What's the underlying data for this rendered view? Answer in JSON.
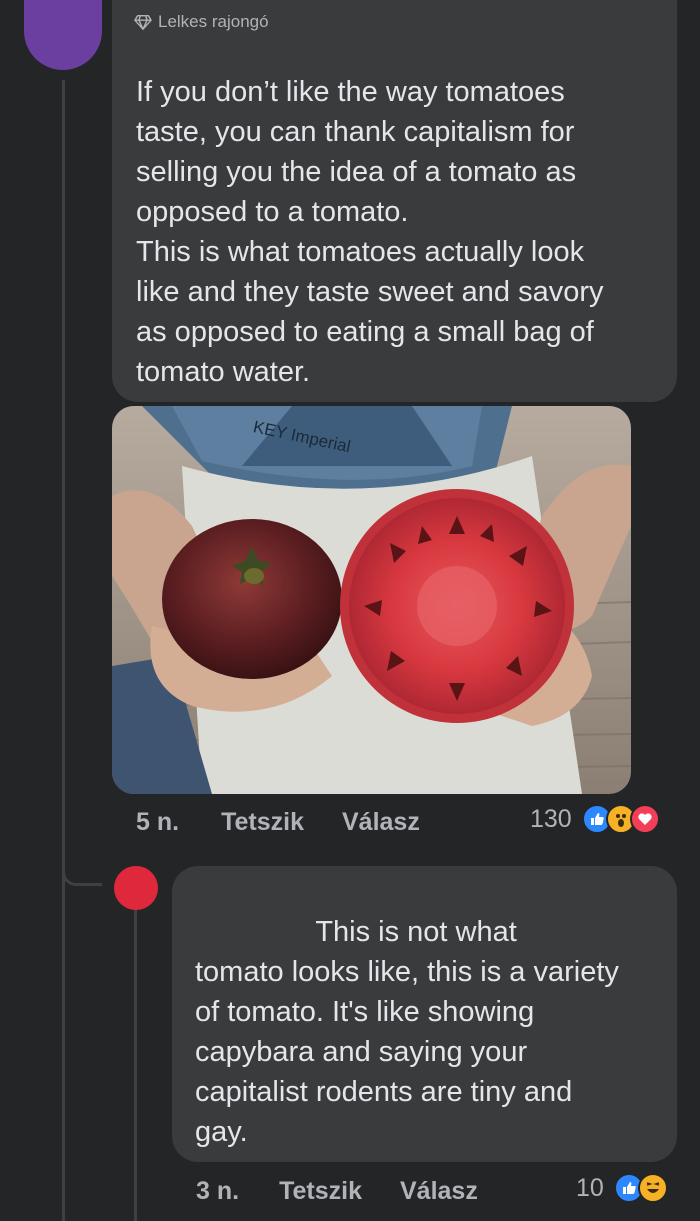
{
  "comment1": {
    "badge": "Lelkes rajongó",
    "text": "If you don’t like the way tomatoes\ntaste, you can thank capitalism for\nselling you the idea of a tomato as\nopposed to a tomato.\nThis is what tomatoes actually look\nlike and they taste sweet and savory\nas opposed to eating a small bag of\ntomato water.",
    "time": "5 n.",
    "like_label": "Tetszik",
    "reply_label": "Válasz",
    "reaction_count": "130",
    "reactions": [
      "like-icon",
      "wow-icon",
      "love-icon"
    ],
    "avatar_color": "#6b3fa0"
  },
  "comment2": {
    "text": "               This is not what\ntomato looks like, this is a variety\nof tomato. It's like showing\ncapybara and saying your\ncapitalist rodents are tiny and\ngay.",
    "time": "3 n.",
    "like_label": "Tetszik",
    "reply_label": "Válasz",
    "reaction_count": "10",
    "reactions": [
      "like-icon",
      "haha-icon"
    ],
    "avatar_color": "#e0283c"
  },
  "photo": {
    "apron_label": "KEY Imperial"
  }
}
